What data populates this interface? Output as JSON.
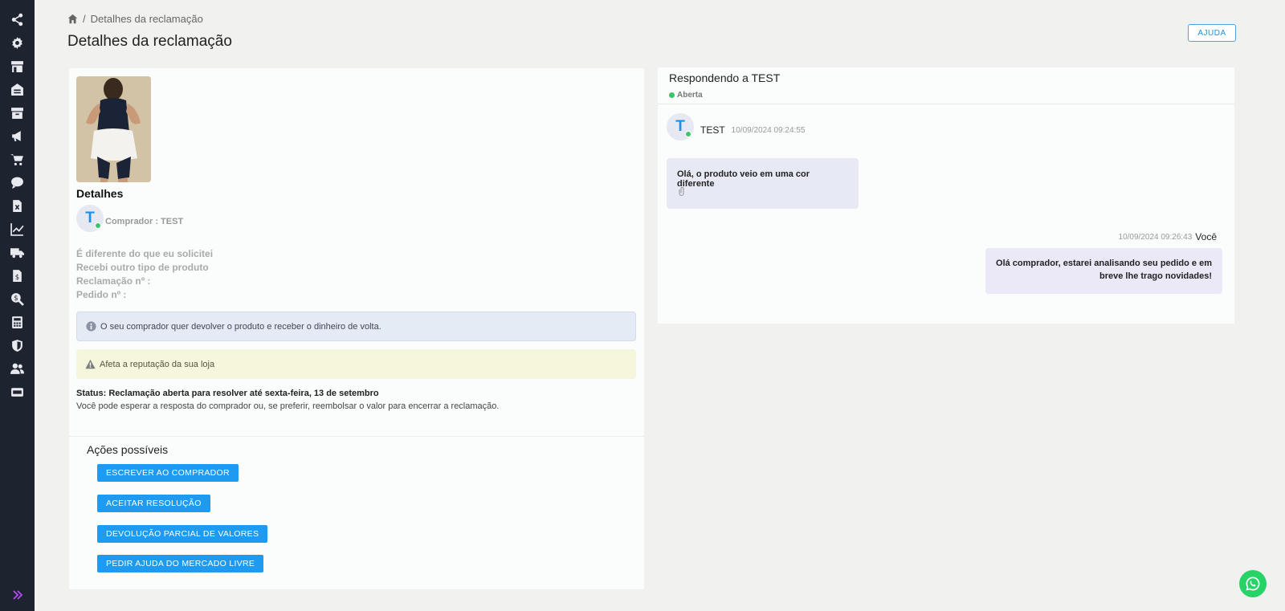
{
  "sidebar": {
    "icons": [
      "share-icon",
      "gear-icon",
      "store-icon",
      "warehouse-icon",
      "archive-icon",
      "megaphone-icon",
      "cart-icon",
      "chat-icon",
      "excel-icon",
      "chart-line-icon",
      "truck-icon",
      "invoice-icon",
      "search-dollar-icon",
      "calculator-icon",
      "shield-icon",
      "users-icon",
      "server-icon"
    ],
    "expand_icon": "double-chevron-right-icon"
  },
  "header": {
    "breadcrumb_current": "Detalhes da reclamação",
    "title": "Detalhes da reclamação",
    "help_label": "AJUDA"
  },
  "details": {
    "title": "Detalhes",
    "avatar_letter": "T",
    "buyer": "Comprador : TEST",
    "reason_1": "É diferente do que eu solicitei",
    "reason_2": "Recebi outro tipo de produto",
    "claim_number": "Reclamação nº :",
    "order_number": "Pedido nº :",
    "info_alert": "O seu comprador quer devolver o produto e receber o dinheiro de volta.",
    "warn_alert": "Afeta a reputação da sua loja",
    "status": "Status: Reclamação aberta para resolver até sexta-feira, 13 de setembro",
    "status_sub": "Você pode esperar a resposta do comprador ou, se preferir, reembolsar o valor para encerrar a reclamação."
  },
  "actions": {
    "title": "Ações possíveis",
    "buttons": [
      "ESCREVER AO COMPRADOR",
      "ACEITAR RESOLUÇÃO",
      "DEVOLUÇÃO PARCIAL DE VALORES",
      "PEDIR AJUDA DO MERCADO LIVRE"
    ]
  },
  "chat": {
    "title": "Respondendo a TEST",
    "state": "Aberta",
    "incoming": {
      "avatar_letter": "T",
      "name": "TEST",
      "time": "10/09/2024 09:24:55",
      "text": "Olá, o produto veio em uma cor diferente"
    },
    "outgoing": {
      "time": "10/09/2024 09:26:43",
      "name": "Você",
      "line_1": "Olá comprador, estarei analisando seu pedido e em",
      "line_2": "breve lhe trago novidades!"
    }
  },
  "colors": {
    "sidebar_bg": "#1e2330",
    "primary": "#1e9af0",
    "online": "#3cc36b",
    "whatsapp": "#25d366"
  }
}
